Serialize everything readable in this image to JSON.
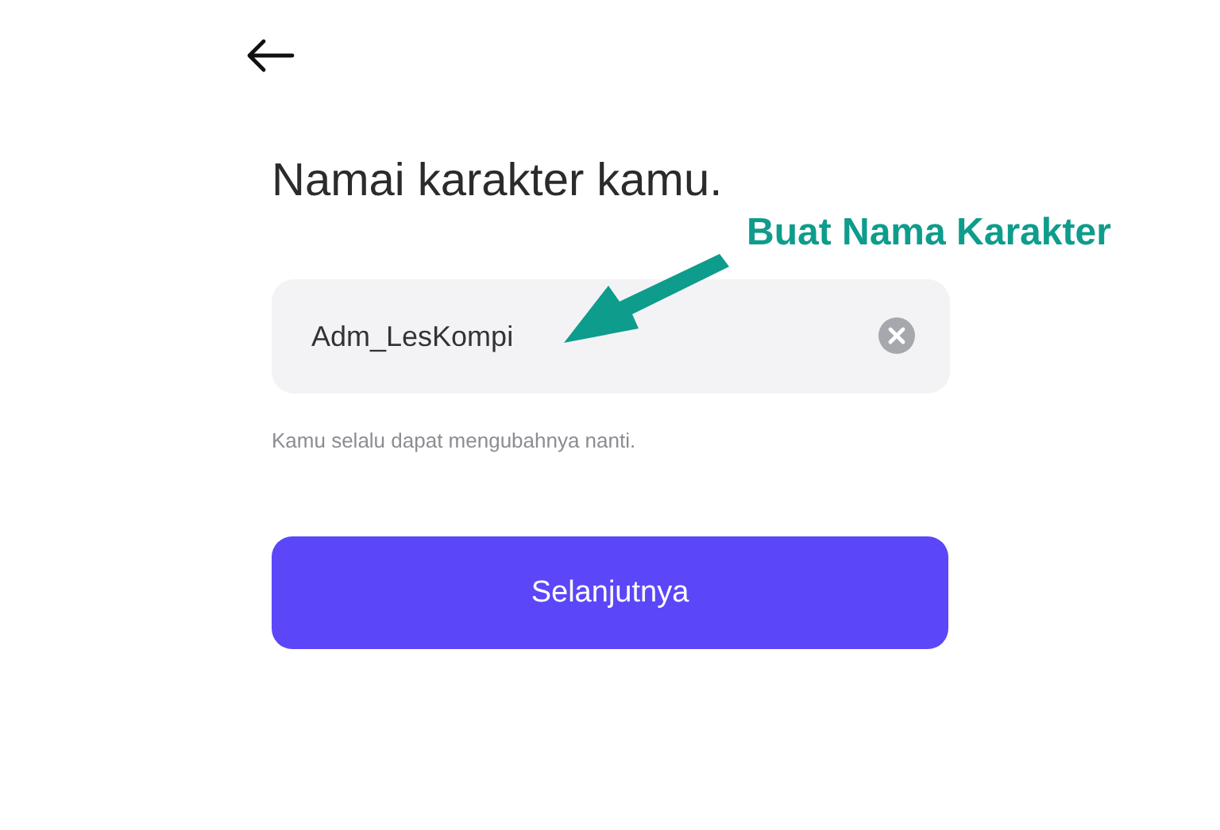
{
  "title": "Namai karakter kamu.",
  "name_field": {
    "value": "Adm_LesKompi"
  },
  "hint": "Kamu selalu dapat mengubahnya nanti.",
  "next_button": {
    "label": "Selanjutnya"
  },
  "annotation": {
    "label": "Buat Nama Karakter"
  }
}
